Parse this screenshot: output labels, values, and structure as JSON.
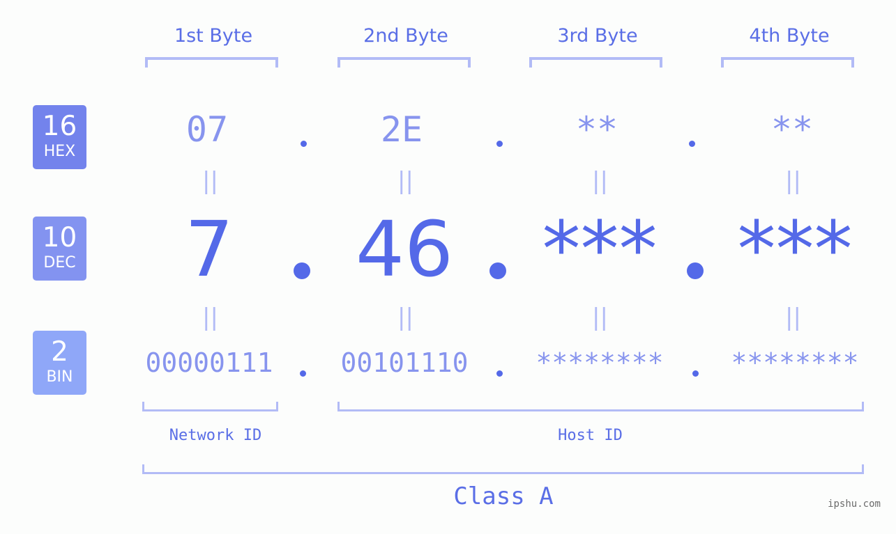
{
  "bytes": [
    {
      "header": "1st Byte",
      "hex": "07",
      "dec": "7",
      "bin": "00000111"
    },
    {
      "header": "2nd Byte",
      "hex": "2E",
      "dec": "46",
      "bin": "00101110"
    },
    {
      "header": "3rd Byte",
      "hex": "**",
      "dec": "***",
      "bin": "********"
    },
    {
      "header": "4th Byte",
      "hex": "**",
      "dec": "***",
      "bin": "********"
    }
  ],
  "bases": {
    "hex": {
      "num": "16",
      "label": "HEX",
      "color": "#7383ec"
    },
    "dec": {
      "num": "10",
      "label": "DEC",
      "color": "#8393f0"
    },
    "bin": {
      "num": "2",
      "label": "BIN",
      "color": "#8fa7f8"
    }
  },
  "equals_symbol": "||",
  "network_id_label": "Network ID",
  "host_id_label": "Host ID",
  "class_label": "Class A",
  "watermark": "ipshu.com",
  "colors": {
    "accent": "#5469e8",
    "muted": "#8794ee",
    "bracket": "#b2bbf6",
    "background": "#fcfdfc"
  }
}
